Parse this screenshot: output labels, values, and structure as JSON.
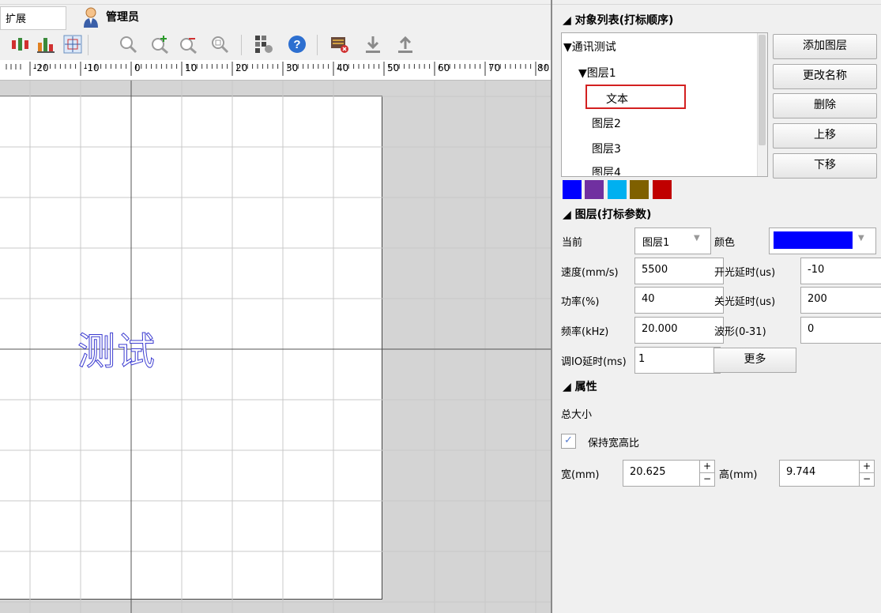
{
  "toolbar": {
    "menu_label": "扩展",
    "user_name": "管理员"
  },
  "ruler": {
    "labels": [
      "-20",
      "-10",
      "0",
      "10",
      "20",
      "30",
      "40",
      "50",
      "60",
      "70",
      "80"
    ]
  },
  "canvas": {
    "mark_text": "测试"
  },
  "object_list": {
    "title": "◢ 对象列表(打标顺序)",
    "tree": [
      {
        "label": "▼通讯测试"
      },
      {
        "label": "▼图层1"
      },
      {
        "label": "文本",
        "selected": true
      },
      {
        "label": "图层2"
      },
      {
        "label": "图层3"
      },
      {
        "label": "图层4"
      }
    ],
    "buttons": [
      "添加图层",
      "更改名称",
      "删除",
      "上移",
      "下移"
    ],
    "swatches": [
      "#0000ff",
      "#7030a0",
      "#00b0f0",
      "#7f6000",
      "#c00000"
    ]
  },
  "layer_params": {
    "title": "◢ 图层(打标参数)",
    "current_label": "当前",
    "current_value": "图层1",
    "color_label": "颜色",
    "color_value": "#0000ff",
    "speed_label": "速度(mm/s)",
    "speed_value": "5500",
    "on_delay_label": "开光延时(us)",
    "on_delay_value": "-10",
    "power_label": "功率(%)",
    "power_value": "40",
    "off_delay_label": "关光延时(us)",
    "off_delay_value": "200",
    "freq_label": "频率(kHz)",
    "freq_value": "20.000",
    "wave_label": "波形(0-31)",
    "wave_value": "0",
    "io_delay_label": "调IO延时(ms)",
    "io_delay_value": "1",
    "more_button": "更多"
  },
  "properties": {
    "title": "◢ 属性",
    "total_size_label": "总大小",
    "keep_ratio_label": "保持宽高比",
    "keep_ratio_checked": true,
    "width_label": "宽(mm)",
    "width_value": "20.625",
    "height_label": "高(mm)",
    "height_value": "9.744"
  }
}
